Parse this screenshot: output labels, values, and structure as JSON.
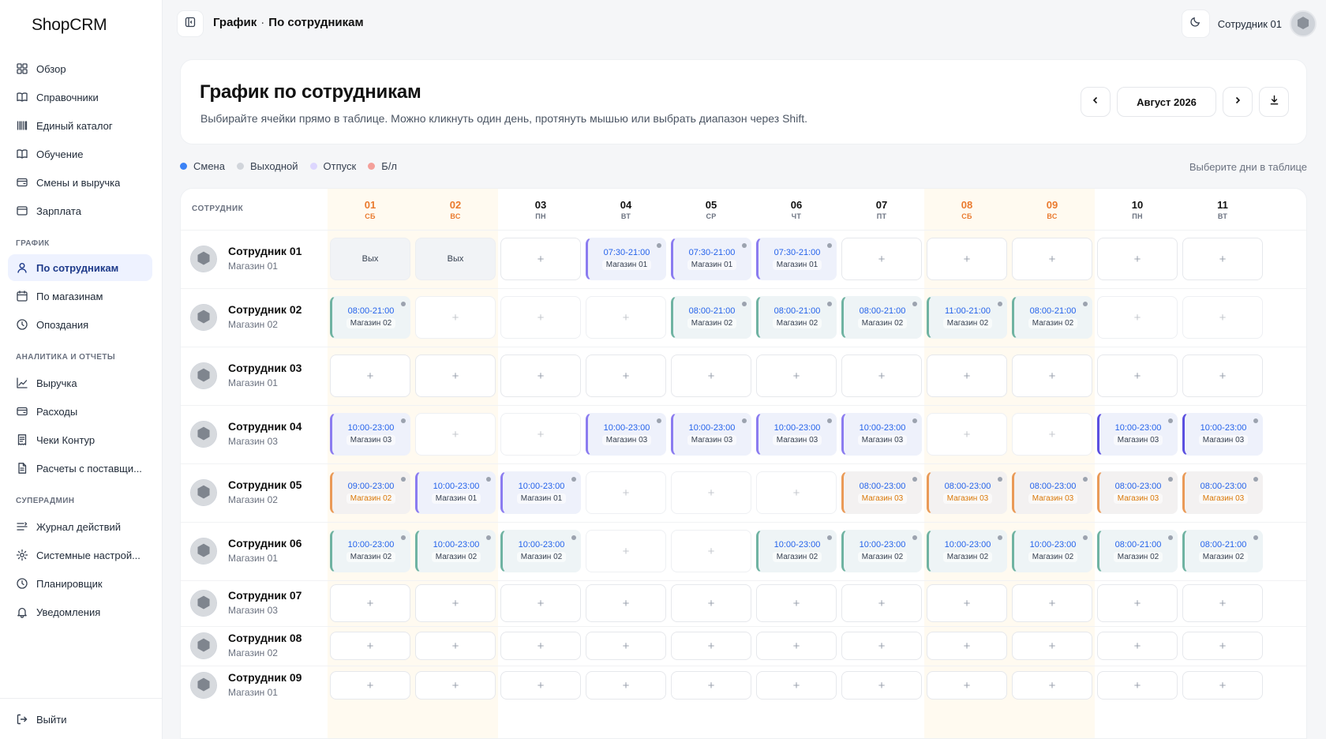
{
  "app": {
    "name": "ShopCRM"
  },
  "colors": {
    "accent": "#2563eb",
    "weekend": "#ea7a2e",
    "active_nav_bg": "#eef2ff"
  },
  "sidebar": {
    "items_top": [
      {
        "label": "Обзор",
        "icon": "grid-icon"
      },
      {
        "label": "Справочники",
        "icon": "book-icon"
      },
      {
        "label": "Единый каталог",
        "icon": "barcode-icon"
      },
      {
        "label": "Обучение",
        "icon": "book-open-icon"
      },
      {
        "label": "Смены и выручка",
        "icon": "wallet-icon"
      },
      {
        "label": "Зарплата",
        "icon": "folder-icon"
      }
    ],
    "section_schedule": "ГРАФИК",
    "items_schedule": [
      {
        "label": "По сотрудникам",
        "icon": "user-icon",
        "active": true
      },
      {
        "label": "По магазинам",
        "icon": "calendar-icon"
      },
      {
        "label": "Опоздания",
        "icon": "clock-icon"
      }
    ],
    "section_analytics": "АНАЛИТИКА И ОТЧЕТЫ",
    "items_analytics": [
      {
        "label": "Выручка",
        "icon": "line-chart-icon"
      },
      {
        "label": "Расходы",
        "icon": "wallet-icon"
      },
      {
        "label": "Чеки Контур",
        "icon": "receipt-icon"
      },
      {
        "label": "Расчеты с поставщи...",
        "icon": "document-icon"
      }
    ],
    "section_admin": "СУПЕРАДМИН",
    "items_admin": [
      {
        "label": "Журнал действий",
        "icon": "list-icon"
      },
      {
        "label": "Системные настрой...",
        "icon": "gear-icon"
      },
      {
        "label": "Планировщик",
        "icon": "clock-icon"
      },
      {
        "label": "Уведомления",
        "icon": "bell-icon"
      }
    ],
    "logout": "Выйти"
  },
  "topbar": {
    "breadcrumb_root": "График",
    "breadcrumb_sep": "·",
    "breadcrumb_current": "По сотрудникам",
    "user_name": "Сотрудник 01"
  },
  "header": {
    "title": "График по сотрудникам",
    "subtitle": "Выбирайте ячейки прямо в таблице. Можно кликнуть один день, протянуть мышью или выбрать диапазон через Shift.",
    "month": "Август 2026"
  },
  "legend": [
    {
      "label": "Смена",
      "color": "#3b82f6"
    },
    {
      "label": "Выходной",
      "color": "#d1d5db"
    },
    {
      "label": "Отпуск",
      "color": "#ddd6fe"
    },
    {
      "label": "Б/л",
      "color": "#f4a09a"
    }
  ],
  "hint": "Выберите дни в таблице",
  "table": {
    "employee_header": "СОТРУДНИК",
    "days": [
      {
        "num": "01",
        "name": "СБ",
        "weekend": true
      },
      {
        "num": "02",
        "name": "ВС",
        "weekend": true
      },
      {
        "num": "03",
        "name": "ПН",
        "weekend": false
      },
      {
        "num": "04",
        "name": "ВТ",
        "weekend": false
      },
      {
        "num": "05",
        "name": "СР",
        "weekend": false
      },
      {
        "num": "06",
        "name": "ЧТ",
        "weekend": false
      },
      {
        "num": "07",
        "name": "ПТ",
        "weekend": false
      },
      {
        "num": "08",
        "name": "СБ",
        "weekend": true
      },
      {
        "num": "09",
        "name": "ВС",
        "weekend": true
      },
      {
        "num": "10",
        "name": "ПН",
        "weekend": false
      },
      {
        "num": "11",
        "name": "ВТ",
        "weekend": false
      }
    ],
    "rows": [
      {
        "name": "Сотрудник 01",
        "store": "Магазин 01",
        "cells": [
          {
            "type": "off",
            "label": "Вых"
          },
          {
            "type": "off",
            "label": "Вых"
          },
          {
            "type": "empty"
          },
          {
            "type": "shift",
            "time": "07:30-21:00",
            "store": "Магазин 01",
            "color": "purple"
          },
          {
            "type": "shift",
            "time": "07:30-21:00",
            "store": "Магазин 01",
            "color": "purple"
          },
          {
            "type": "shift",
            "time": "07:30-21:00",
            "store": "Магазин 01",
            "color": "purple"
          },
          {
            "type": "empty"
          },
          {
            "type": "empty"
          },
          {
            "type": "empty"
          },
          {
            "type": "empty"
          },
          {
            "type": "empty"
          }
        ]
      },
      {
        "name": "Сотрудник 02",
        "store": "Магазин 02",
        "cells": [
          {
            "type": "shift",
            "time": "08:00-21:00",
            "store": "Магазин 02",
            "color": "green"
          },
          {
            "type": "faint"
          },
          {
            "type": "faint"
          },
          {
            "type": "faint"
          },
          {
            "type": "shift",
            "time": "08:00-21:00",
            "store": "Магазин 02",
            "color": "green"
          },
          {
            "type": "shift",
            "time": "08:00-21:00",
            "store": "Магазин 02",
            "color": "green"
          },
          {
            "type": "shift",
            "time": "08:00-21:00",
            "store": "Магазин 02",
            "color": "green"
          },
          {
            "type": "shift",
            "time": "11:00-21:00",
            "store": "Магазин 02",
            "color": "green"
          },
          {
            "type": "shift",
            "time": "08:00-21:00",
            "store": "Магазин 02",
            "color": "green"
          },
          {
            "type": "faint"
          },
          {
            "type": "faint"
          }
        ]
      },
      {
        "name": "Сотрудник 03",
        "store": "Магазин 01",
        "cells": [
          {
            "type": "empty"
          },
          {
            "type": "empty"
          },
          {
            "type": "empty"
          },
          {
            "type": "empty"
          },
          {
            "type": "empty"
          },
          {
            "type": "empty"
          },
          {
            "type": "empty"
          },
          {
            "type": "empty"
          },
          {
            "type": "empty"
          },
          {
            "type": "empty"
          },
          {
            "type": "empty"
          }
        ]
      },
      {
        "name": "Сотрудник 04",
        "store": "Магазин 03",
        "cells": [
          {
            "type": "shift",
            "time": "10:00-23:00",
            "store": "Магазин 03",
            "color": "purple"
          },
          {
            "type": "faint"
          },
          {
            "type": "faint"
          },
          {
            "type": "shift",
            "time": "10:00-23:00",
            "store": "Магазин 03",
            "color": "purple"
          },
          {
            "type": "shift",
            "time": "10:00-23:00",
            "store": "Магазин 03",
            "color": "purple"
          },
          {
            "type": "shift",
            "time": "10:00-23:00",
            "store": "Магазин 03",
            "color": "purple"
          },
          {
            "type": "shift",
            "time": "10:00-23:00",
            "store": "Магазин 03",
            "color": "purple"
          },
          {
            "type": "faint"
          },
          {
            "type": "faint"
          },
          {
            "type": "shift",
            "time": "10:00-23:00",
            "store": "Магазин 03",
            "color": "indigo"
          },
          {
            "type": "shift",
            "time": "10:00-23:00",
            "store": "Магазин 03",
            "color": "indigo"
          }
        ]
      },
      {
        "name": "Сотрудник 05",
        "store": "Магазин 02",
        "cells": [
          {
            "type": "shift",
            "time": "09:00-23:00",
            "store": "Магазин 02",
            "color": "orange"
          },
          {
            "type": "shift",
            "time": "10:00-23:00",
            "store": "Магазин 01",
            "color": "purple"
          },
          {
            "type": "shift",
            "time": "10:00-23:00",
            "store": "Магазин 01",
            "color": "purple"
          },
          {
            "type": "faint"
          },
          {
            "type": "faint"
          },
          {
            "type": "faint"
          },
          {
            "type": "shift",
            "time": "08:00-23:00",
            "store": "Магазин 03",
            "color": "orange"
          },
          {
            "type": "shift",
            "time": "08:00-23:00",
            "store": "Магазин 03",
            "color": "orange"
          },
          {
            "type": "shift",
            "time": "08:00-23:00",
            "store": "Магазин 03",
            "color": "orange"
          },
          {
            "type": "shift",
            "time": "08:00-23:00",
            "store": "Магазин 03",
            "color": "orange"
          },
          {
            "type": "shift",
            "time": "08:00-23:00",
            "store": "Магазин 03",
            "color": "orange"
          }
        ]
      },
      {
        "name": "Сотрудник 06",
        "store": "Магазин 01",
        "cells": [
          {
            "type": "shift",
            "time": "10:00-23:00",
            "store": "Магазин 02",
            "color": "green"
          },
          {
            "type": "shift",
            "time": "10:00-23:00",
            "store": "Магазин 02",
            "color": "green"
          },
          {
            "type": "shift",
            "time": "10:00-23:00",
            "store": "Магазин 02",
            "color": "green"
          },
          {
            "type": "faint"
          },
          {
            "type": "faint"
          },
          {
            "type": "shift",
            "time": "10:00-23:00",
            "store": "Магазин 02",
            "color": "green"
          },
          {
            "type": "shift",
            "time": "10:00-23:00",
            "store": "Магазин 02",
            "color": "green"
          },
          {
            "type": "shift",
            "time": "10:00-23:00",
            "store": "Магазин 02",
            "color": "green"
          },
          {
            "type": "shift",
            "time": "10:00-23:00",
            "store": "Магазин 02",
            "color": "green"
          },
          {
            "type": "shift",
            "time": "08:00-21:00",
            "store": "Магазин 02",
            "color": "green"
          },
          {
            "type": "shift",
            "time": "08:00-21:00",
            "store": "Магазин 02",
            "color": "green"
          }
        ]
      },
      {
        "name": "Сотрудник 07",
        "store": "Магазин 03",
        "cells": [
          {
            "type": "empty"
          },
          {
            "type": "empty"
          },
          {
            "type": "empty"
          },
          {
            "type": "empty"
          },
          {
            "type": "empty"
          },
          {
            "type": "empty"
          },
          {
            "type": "empty"
          },
          {
            "type": "empty"
          },
          {
            "type": "empty"
          },
          {
            "type": "empty"
          },
          {
            "type": "empty"
          }
        ]
      },
      {
        "name": "Сотрудник 08",
        "store": "Магазин 02",
        "cells": [
          {
            "type": "empty"
          },
          {
            "type": "empty"
          },
          {
            "type": "empty"
          },
          {
            "type": "empty"
          },
          {
            "type": "empty"
          },
          {
            "type": "empty"
          },
          {
            "type": "empty"
          },
          {
            "type": "empty"
          },
          {
            "type": "empty"
          },
          {
            "type": "empty"
          },
          {
            "type": "empty"
          }
        ]
      },
      {
        "name": "Сотрудник 09",
        "store": "Магазин 01",
        "cells": [
          {
            "type": "empty"
          },
          {
            "type": "empty"
          },
          {
            "type": "empty"
          },
          {
            "type": "empty"
          },
          {
            "type": "empty"
          },
          {
            "type": "empty"
          },
          {
            "type": "empty"
          },
          {
            "type": "empty"
          },
          {
            "type": "empty"
          },
          {
            "type": "empty"
          },
          {
            "type": "empty"
          }
        ]
      }
    ],
    "add_glyph": "+"
  }
}
